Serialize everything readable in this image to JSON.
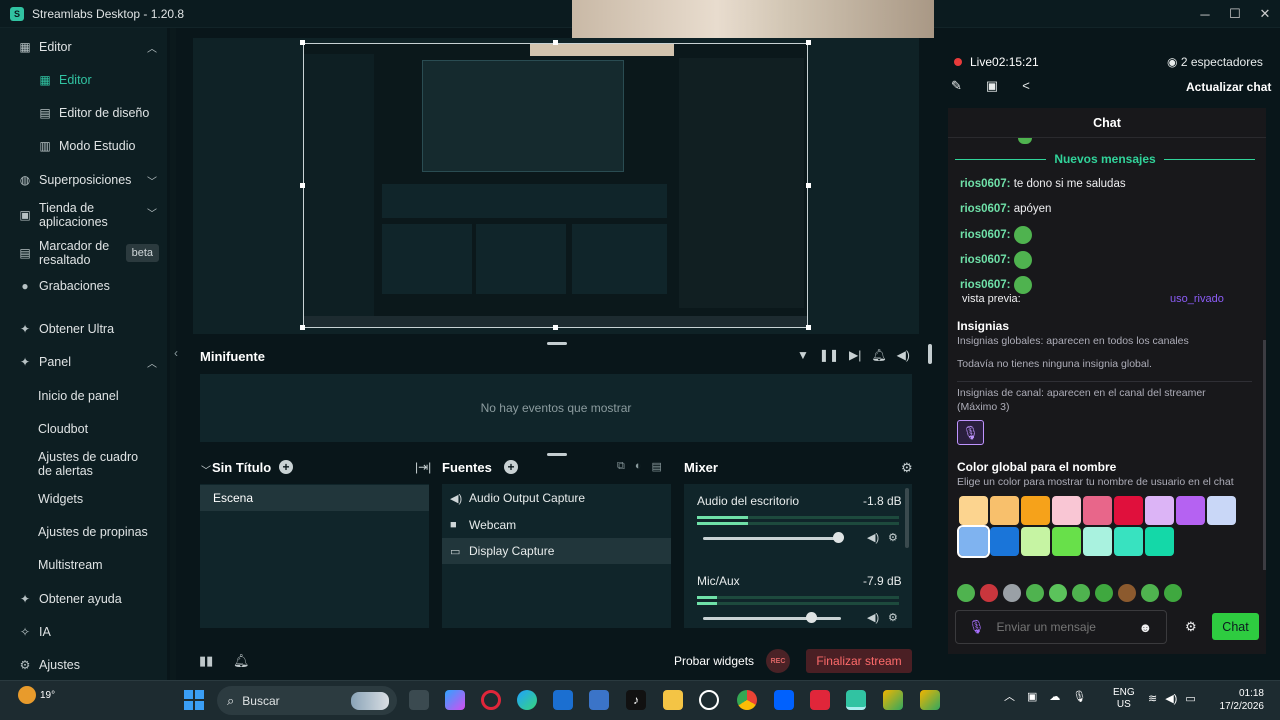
{
  "window": {
    "title": "Streamlabs Desktop - 1.20.8",
    "minimize": "─",
    "maximize": "☐",
    "close": "✕"
  },
  "sidebar": {
    "items": [
      {
        "label": "Editor",
        "icon": "editor-icon"
      },
      {
        "label": "Editor",
        "icon": "editor-sub-icon"
      },
      {
        "label": "Editor de diseño",
        "icon": "layout-icon"
      },
      {
        "label": "Modo Estudio",
        "icon": "studio-icon"
      },
      {
        "label": "Superposiciones",
        "icon": "overlays-icon"
      },
      {
        "label": "Tienda de aplicaciones",
        "icon": "store-icon"
      },
      {
        "label": "Marcador de resaltado",
        "icon": "highlighter-icon",
        "badge": "beta"
      },
      {
        "label": "Grabaciones",
        "icon": "recordings-icon"
      },
      {
        "label": "Obtener Ultra",
        "icon": "ultra-icon"
      },
      {
        "label": "Panel",
        "icon": "dashboard-icon"
      },
      {
        "label": "Inicio de panel"
      },
      {
        "label": "Cloudbot"
      },
      {
        "label": "Ajustes de cuadro de alertas"
      },
      {
        "label": "Widgets"
      },
      {
        "label": "Ajustes de propinas"
      },
      {
        "label": "Multistream"
      },
      {
        "label": "Obtener ayuda",
        "icon": "help-icon"
      },
      {
        "label": "IA",
        "icon": "ai-icon"
      },
      {
        "label": "Ajustes",
        "icon": "settings-icon"
      }
    ]
  },
  "minifuente": {
    "title": "Minifuente",
    "empty": "No hay eventos que mostrar"
  },
  "scenes": {
    "title": "Sin Título",
    "items": [
      "Escena"
    ]
  },
  "sources": {
    "title": "Fuentes",
    "items": [
      "Audio Output Capture",
      "Webcam",
      "Display Capture"
    ]
  },
  "mixer": {
    "title": "Mixer",
    "channels": [
      {
        "name": "Audio del escritorio",
        "db": "-1.8 dB",
        "level": 0.25,
        "volume": 0.98
      },
      {
        "name": "Mic/Aux",
        "db": "-7.9 dB",
        "level": 0.1,
        "volume": 0.78
      }
    ]
  },
  "footer": {
    "test_widgets": "Probar widgets",
    "rec": "REC",
    "end_stream": "Finalizar stream"
  },
  "stream": {
    "live": "Live",
    "duration": "02:15:21",
    "viewers": "2 espectadores",
    "refresh_chat": "Actualizar chat"
  },
  "chat": {
    "title": "Chat",
    "new_messages": "Nuevos mensajes",
    "messages": [
      {
        "user": "rios0607:",
        "text": "te dono si me saludas"
      },
      {
        "user": "rios0607:",
        "text": "apóyen"
      },
      {
        "user": "rios0607:",
        "text": ""
      },
      {
        "user": "rios0607:",
        "text": ""
      },
      {
        "user": "rios0607:",
        "text": ""
      }
    ],
    "preview_label": "vista previa:",
    "preview_user": "uso_rivado",
    "insignias_title": "Insignias",
    "global_badges": "Insignias globales: aparecen en todos los canales",
    "no_global": "Todavía no tienes ninguna insignia global.",
    "channel_badges": "Insignias de canal: aparecen en el canal del streamer (Máximo 3)",
    "color_title": "Color global para el nombre",
    "color_desc": "Elige un color para mostrar tu nombre de usuario en el chat",
    "swatches": [
      "#fcd48f",
      "#f8c06c",
      "#f6a21a",
      "#f9c6d4",
      "#e8668a",
      "#e0103c",
      "#dcb4f6",
      "#b562f2",
      "#c9d7f7",
      "#7fb3f0",
      "#1a75d9",
      "#c6f4a3",
      "#68e04a",
      "#a9f2df",
      "#38e2c0",
      "#14d8a8"
    ],
    "input_placeholder": "Enviar un mensaje",
    "send": "Chat"
  },
  "taskbar": {
    "temp": "19°",
    "search": "Buscar",
    "lang1": "ENG",
    "lang2": "US",
    "time": "01:18",
    "date": "17/2/2026"
  }
}
